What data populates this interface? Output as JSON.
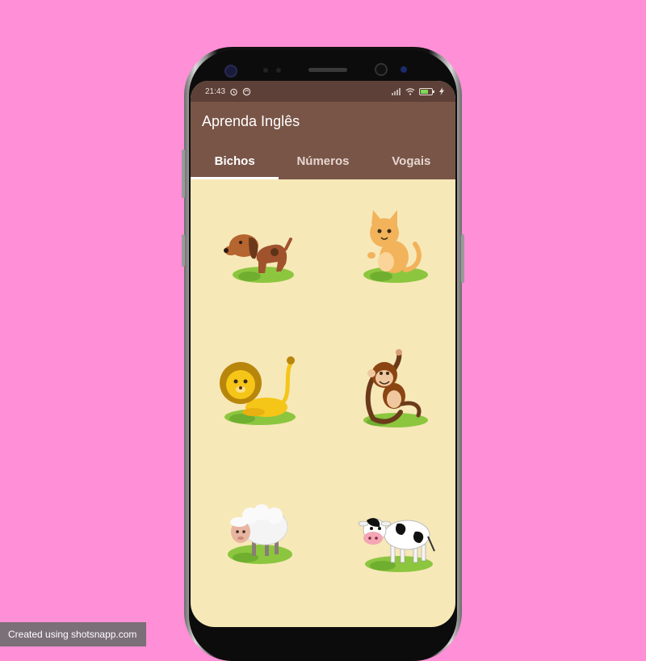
{
  "status_bar": {
    "time": "21:43",
    "icons": [
      "alarm-icon",
      "sync-icon",
      "signal-icon",
      "wifi-icon",
      "battery-icon",
      "charging-icon"
    ]
  },
  "app_bar": {
    "title": "Aprenda Inglês"
  },
  "tabs": [
    {
      "label": "Bichos",
      "active": true
    },
    {
      "label": "Números",
      "active": false
    },
    {
      "label": "Vogais",
      "active": false
    }
  ],
  "animals": [
    "dog",
    "cat",
    "lion",
    "monkey",
    "sheep",
    "cow"
  ],
  "colors": {
    "background": "#ff8fd6",
    "app_bar": "#795548",
    "status_bar": "#5d4037",
    "content": "#f7e8b8"
  },
  "watermark": "Created using shotsnapp.com"
}
